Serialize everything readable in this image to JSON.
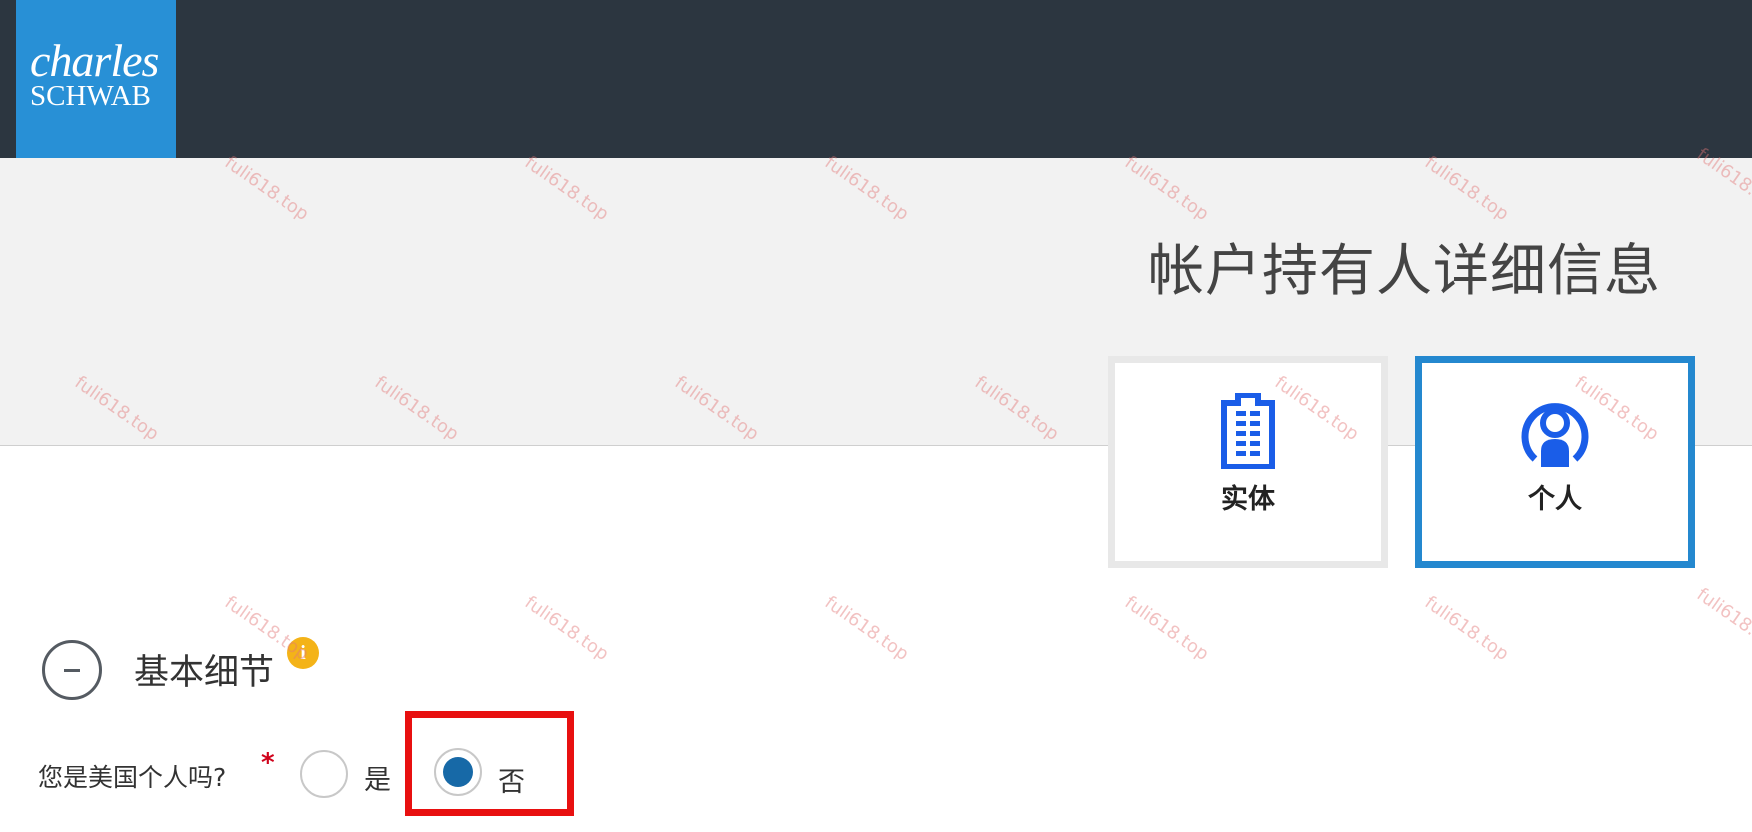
{
  "brand": {
    "line1": "charles",
    "line2": "SCHWAB"
  },
  "page": {
    "title": "帐户持有人详细信息"
  },
  "account_types": [
    {
      "label": "实体",
      "icon": "building-icon",
      "selected": false
    },
    {
      "label": "个人",
      "icon": "person-icon",
      "selected": true
    }
  ],
  "section": {
    "title": "基本细节",
    "info_icon": "i"
  },
  "form": {
    "question": "您是美国个人吗?",
    "required_mark": "*",
    "options": [
      {
        "label": "是",
        "selected": false
      },
      {
        "label": "否",
        "selected": true
      }
    ]
  },
  "watermark_text": "fuli618.top",
  "colors": {
    "topbar": "#2c3640",
    "brand_blue": "#2890d6",
    "selected_border": "#2488cf",
    "radio_fill": "#1769a7",
    "highlight": "#e81010",
    "info": "#f4b318"
  }
}
